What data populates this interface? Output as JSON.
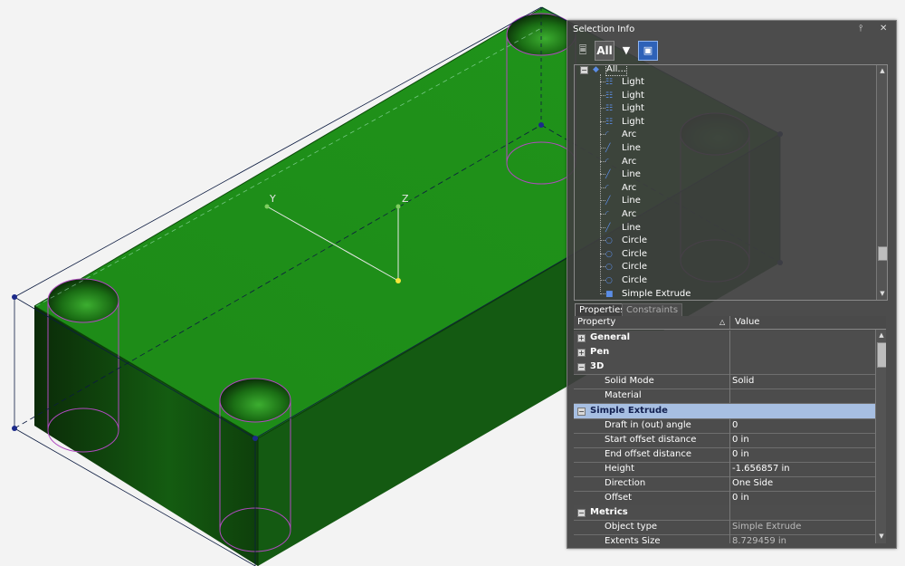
{
  "scene": {
    "axis_y_label": "Y",
    "axis_z_label": "Z",
    "colors": {
      "solid_top": "#1f8f1a",
      "solid_side": "#0f3a0c",
      "solid_front": "#145a10",
      "edge_highlight": "#b04ac0"
    }
  },
  "panel": {
    "title": "Selection Info",
    "pin_icon": "pin-icon",
    "close_icon": "close-icon",
    "toolbar": {
      "properties_icon": "properties-icon",
      "all_label": "All",
      "filter_icon": "filter-icon",
      "select_icon": "select-icon"
    },
    "tree": {
      "root_label": "All...",
      "items": [
        {
          "icon": "light-icon",
          "label": "Light"
        },
        {
          "icon": "light-icon",
          "label": "Light"
        },
        {
          "icon": "light-icon",
          "label": "Light"
        },
        {
          "icon": "light-icon",
          "label": "Light"
        },
        {
          "icon": "arc-icon",
          "label": "Arc"
        },
        {
          "icon": "line-icon",
          "label": "Line"
        },
        {
          "icon": "arc-icon",
          "label": "Arc"
        },
        {
          "icon": "line-icon",
          "label": "Line"
        },
        {
          "icon": "arc-icon",
          "label": "Arc"
        },
        {
          "icon": "line-icon",
          "label": "Line"
        },
        {
          "icon": "arc-icon",
          "label": "Arc"
        },
        {
          "icon": "line-icon",
          "label": "Line"
        },
        {
          "icon": "circle-icon",
          "label": "Circle"
        },
        {
          "icon": "circle-icon",
          "label": "Circle"
        },
        {
          "icon": "circle-icon",
          "label": "Circle"
        },
        {
          "icon": "circle-icon",
          "label": "Circle"
        },
        {
          "icon": "extrude-icon",
          "label": "Simple Extrude"
        }
      ]
    },
    "tabs": {
      "properties": "Properties",
      "constraints": "Constraints"
    },
    "grid": {
      "col_property": "Property",
      "col_value": "Value",
      "rows": [
        {
          "type": "category",
          "label": "General",
          "expanded": false
        },
        {
          "type": "category",
          "label": "Pen",
          "expanded": false
        },
        {
          "type": "category",
          "label": "3D",
          "expanded": true
        },
        {
          "type": "prop",
          "label": "Solid Mode",
          "value": "Solid"
        },
        {
          "type": "prop",
          "label": "Material",
          "value": ""
        },
        {
          "type": "category",
          "label": "Simple Extrude",
          "expanded": true,
          "selected": true
        },
        {
          "type": "prop",
          "label": "Draft in (out) angle",
          "value": "0"
        },
        {
          "type": "prop",
          "label": "Start offset distance",
          "value": "0 in"
        },
        {
          "type": "prop",
          "label": "End offset distance",
          "value": "0 in"
        },
        {
          "type": "prop",
          "label": "Height",
          "value": "-1.656857 in"
        },
        {
          "type": "prop",
          "label": "Direction",
          "value": "One Side"
        },
        {
          "type": "prop",
          "label": "Offset",
          "value": "0 in"
        },
        {
          "type": "category",
          "label": "Metrics",
          "expanded": true
        },
        {
          "type": "prop",
          "label": "Object type",
          "value": "Simple Extrude",
          "readonly": true
        },
        {
          "type": "prop",
          "label": "Extents Size",
          "value": "8.729459 in",
          "readonly": true
        }
      ]
    }
  }
}
